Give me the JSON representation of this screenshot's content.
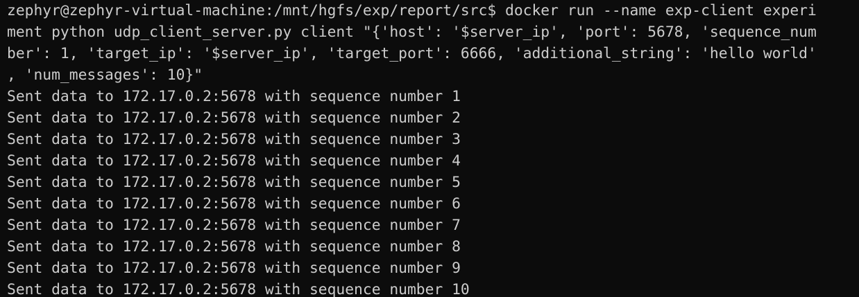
{
  "terminal": {
    "command_lines": [
      "zephyr@zephyr-virtual-machine:/mnt/hgfs/exp/report/src$ docker run --name exp-client experi",
      "ment python udp_client_server.py client \"{'host': '$server_ip', 'port': 5678, 'sequence_num",
      "ber': 1, 'target_ip': '$server_ip', 'target_port': 6666, 'additional_string': 'hello world'",
      ", 'num_messages': 10}\""
    ],
    "output_lines": [
      "Sent data to 172.17.0.2:5678 with sequence number 1",
      "Sent data to 172.17.0.2:5678 with sequence number 2",
      "Sent data to 172.17.0.2:5678 with sequence number 3",
      "Sent data to 172.17.0.2:5678 with sequence number 4",
      "Sent data to 172.17.0.2:5678 with sequence number 5",
      "Sent data to 172.17.0.2:5678 with sequence number 6",
      "Sent data to 172.17.0.2:5678 with sequence number 7",
      "Sent data to 172.17.0.2:5678 with sequence number 8",
      "Sent data to 172.17.0.2:5678 with sequence number 9",
      "Sent data to 172.17.0.2:5678 with sequence number 10"
    ],
    "colors": {
      "background": "#0c0c0c",
      "foreground": "#cccccc"
    }
  }
}
